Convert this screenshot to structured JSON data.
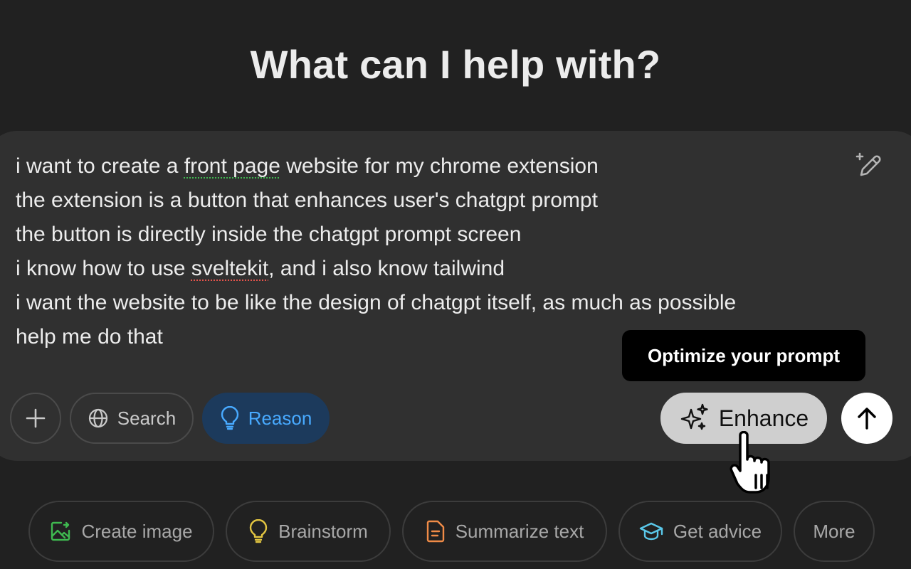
{
  "heading": "What can I help with?",
  "composer": {
    "prompt_lines": [
      [
        "i want to create a ",
        "front page",
        " website for my chrome extension"
      ],
      "the extension is a button that enhances user's chatgpt prompt",
      "the button is directly inside the chatgpt prompt screen",
      [
        "i know how to use ",
        "sveltekit",
        ", and i also know tailwind"
      ],
      "i want the website to be like the design of chatgpt itself, as much as possible",
      "help me do that"
    ],
    "tooltip": "Optimize your prompt",
    "buttons": {
      "search": "Search",
      "reason": "Reason",
      "enhance": "Enhance"
    }
  },
  "suggestions": {
    "create_image": "Create image",
    "brainstorm": "Brainstorm",
    "summarize": "Summarize text",
    "advice": "Get advice",
    "more": "More"
  },
  "colors": {
    "background": "#212121",
    "composer": "#303030",
    "reason_accent": "#48aaff",
    "reason_bg": "#1c3a5c",
    "enhance_bg": "#cfcfcf",
    "create_icon": "#3fb950",
    "brainstorm_icon": "#e2c541",
    "summarize_icon": "#f08b47",
    "advice_icon": "#5ac8ea"
  },
  "icons": {
    "edit": "sparkle-pencil-icon",
    "plus": "plus-icon",
    "search": "globe-icon",
    "reason": "lightbulb-icon",
    "enhance": "sparkles-icon",
    "send": "arrow-up-icon",
    "create_image": "image-icon",
    "brainstorm": "lightbulb-icon",
    "summarize": "document-icon",
    "advice": "graduation-cap-icon",
    "pointer": "hand-cursor-icon"
  }
}
